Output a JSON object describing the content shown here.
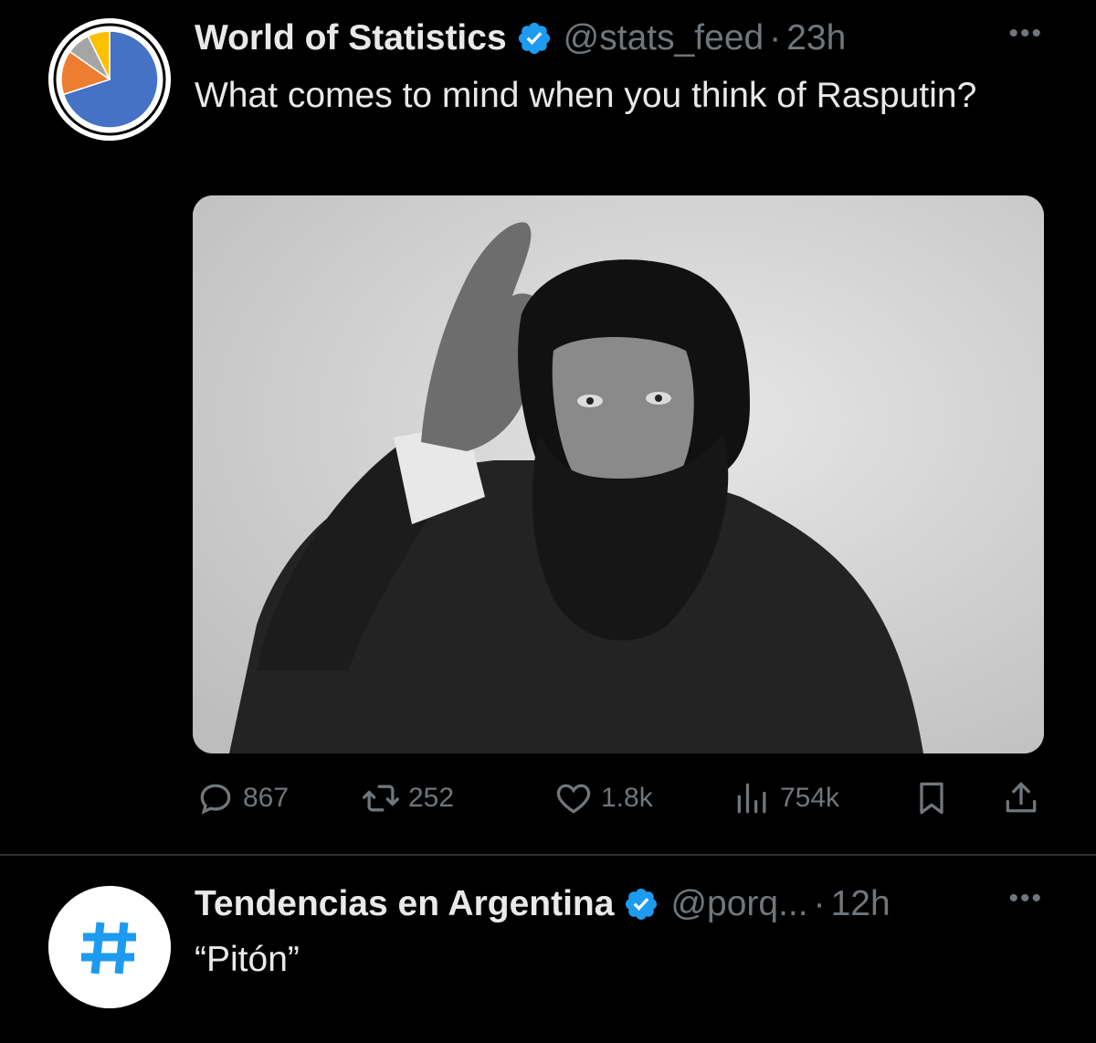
{
  "tweets": [
    {
      "name": "World of Statistics",
      "handle": "@stats_feed",
      "separator": "·",
      "time": "23h",
      "more": "•••",
      "text": "What comes to mind when you think of Rasputin?",
      "avatar_icon": "pie-chart-icon",
      "avatar_colors": [
        "#4472c4",
        "#ed7d31",
        "#a5a5a5",
        "#ffc000"
      ],
      "media_description_icon": "rasputin-photo",
      "stats": {
        "replies": "867",
        "retweets": "252",
        "likes": "1.8k",
        "views": "754k"
      }
    },
    {
      "name": "Tendencias en Argentina",
      "handle": "@porq...",
      "separator": "·",
      "time": "12h",
      "more": "•••",
      "text": "“Pitón”",
      "avatar_icon": "hashtag-icon",
      "avatar_glyph": "#"
    }
  ],
  "colors": {
    "background": "#000000",
    "text": "#e7e9ea",
    "muted": "#71767b",
    "verified": "#1d9bf0",
    "divider": "#2f3336",
    "hashtag": "#1d9bf0"
  }
}
